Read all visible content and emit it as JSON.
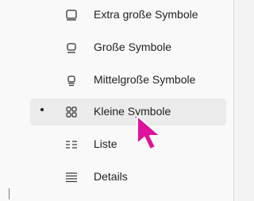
{
  "menu": {
    "items": [
      {
        "label": "Extra große Symbole",
        "icon": "extra-large-icons-icon",
        "selected": false
      },
      {
        "label": "Große Symbole",
        "icon": "large-icons-icon",
        "selected": false
      },
      {
        "label": "Mittelgroße Symbole",
        "icon": "medium-icons-icon",
        "selected": false
      },
      {
        "label": "Kleine Symbole",
        "icon": "small-icons-icon",
        "selected": true
      },
      {
        "label": "Liste",
        "icon": "list-icon",
        "selected": false
      },
      {
        "label": "Details",
        "icon": "details-icon",
        "selected": false
      }
    ]
  },
  "colors": {
    "menu_bg": "#f9f9f9",
    "selected_bg": "#ebebeb",
    "cursor": "#e0119c"
  }
}
